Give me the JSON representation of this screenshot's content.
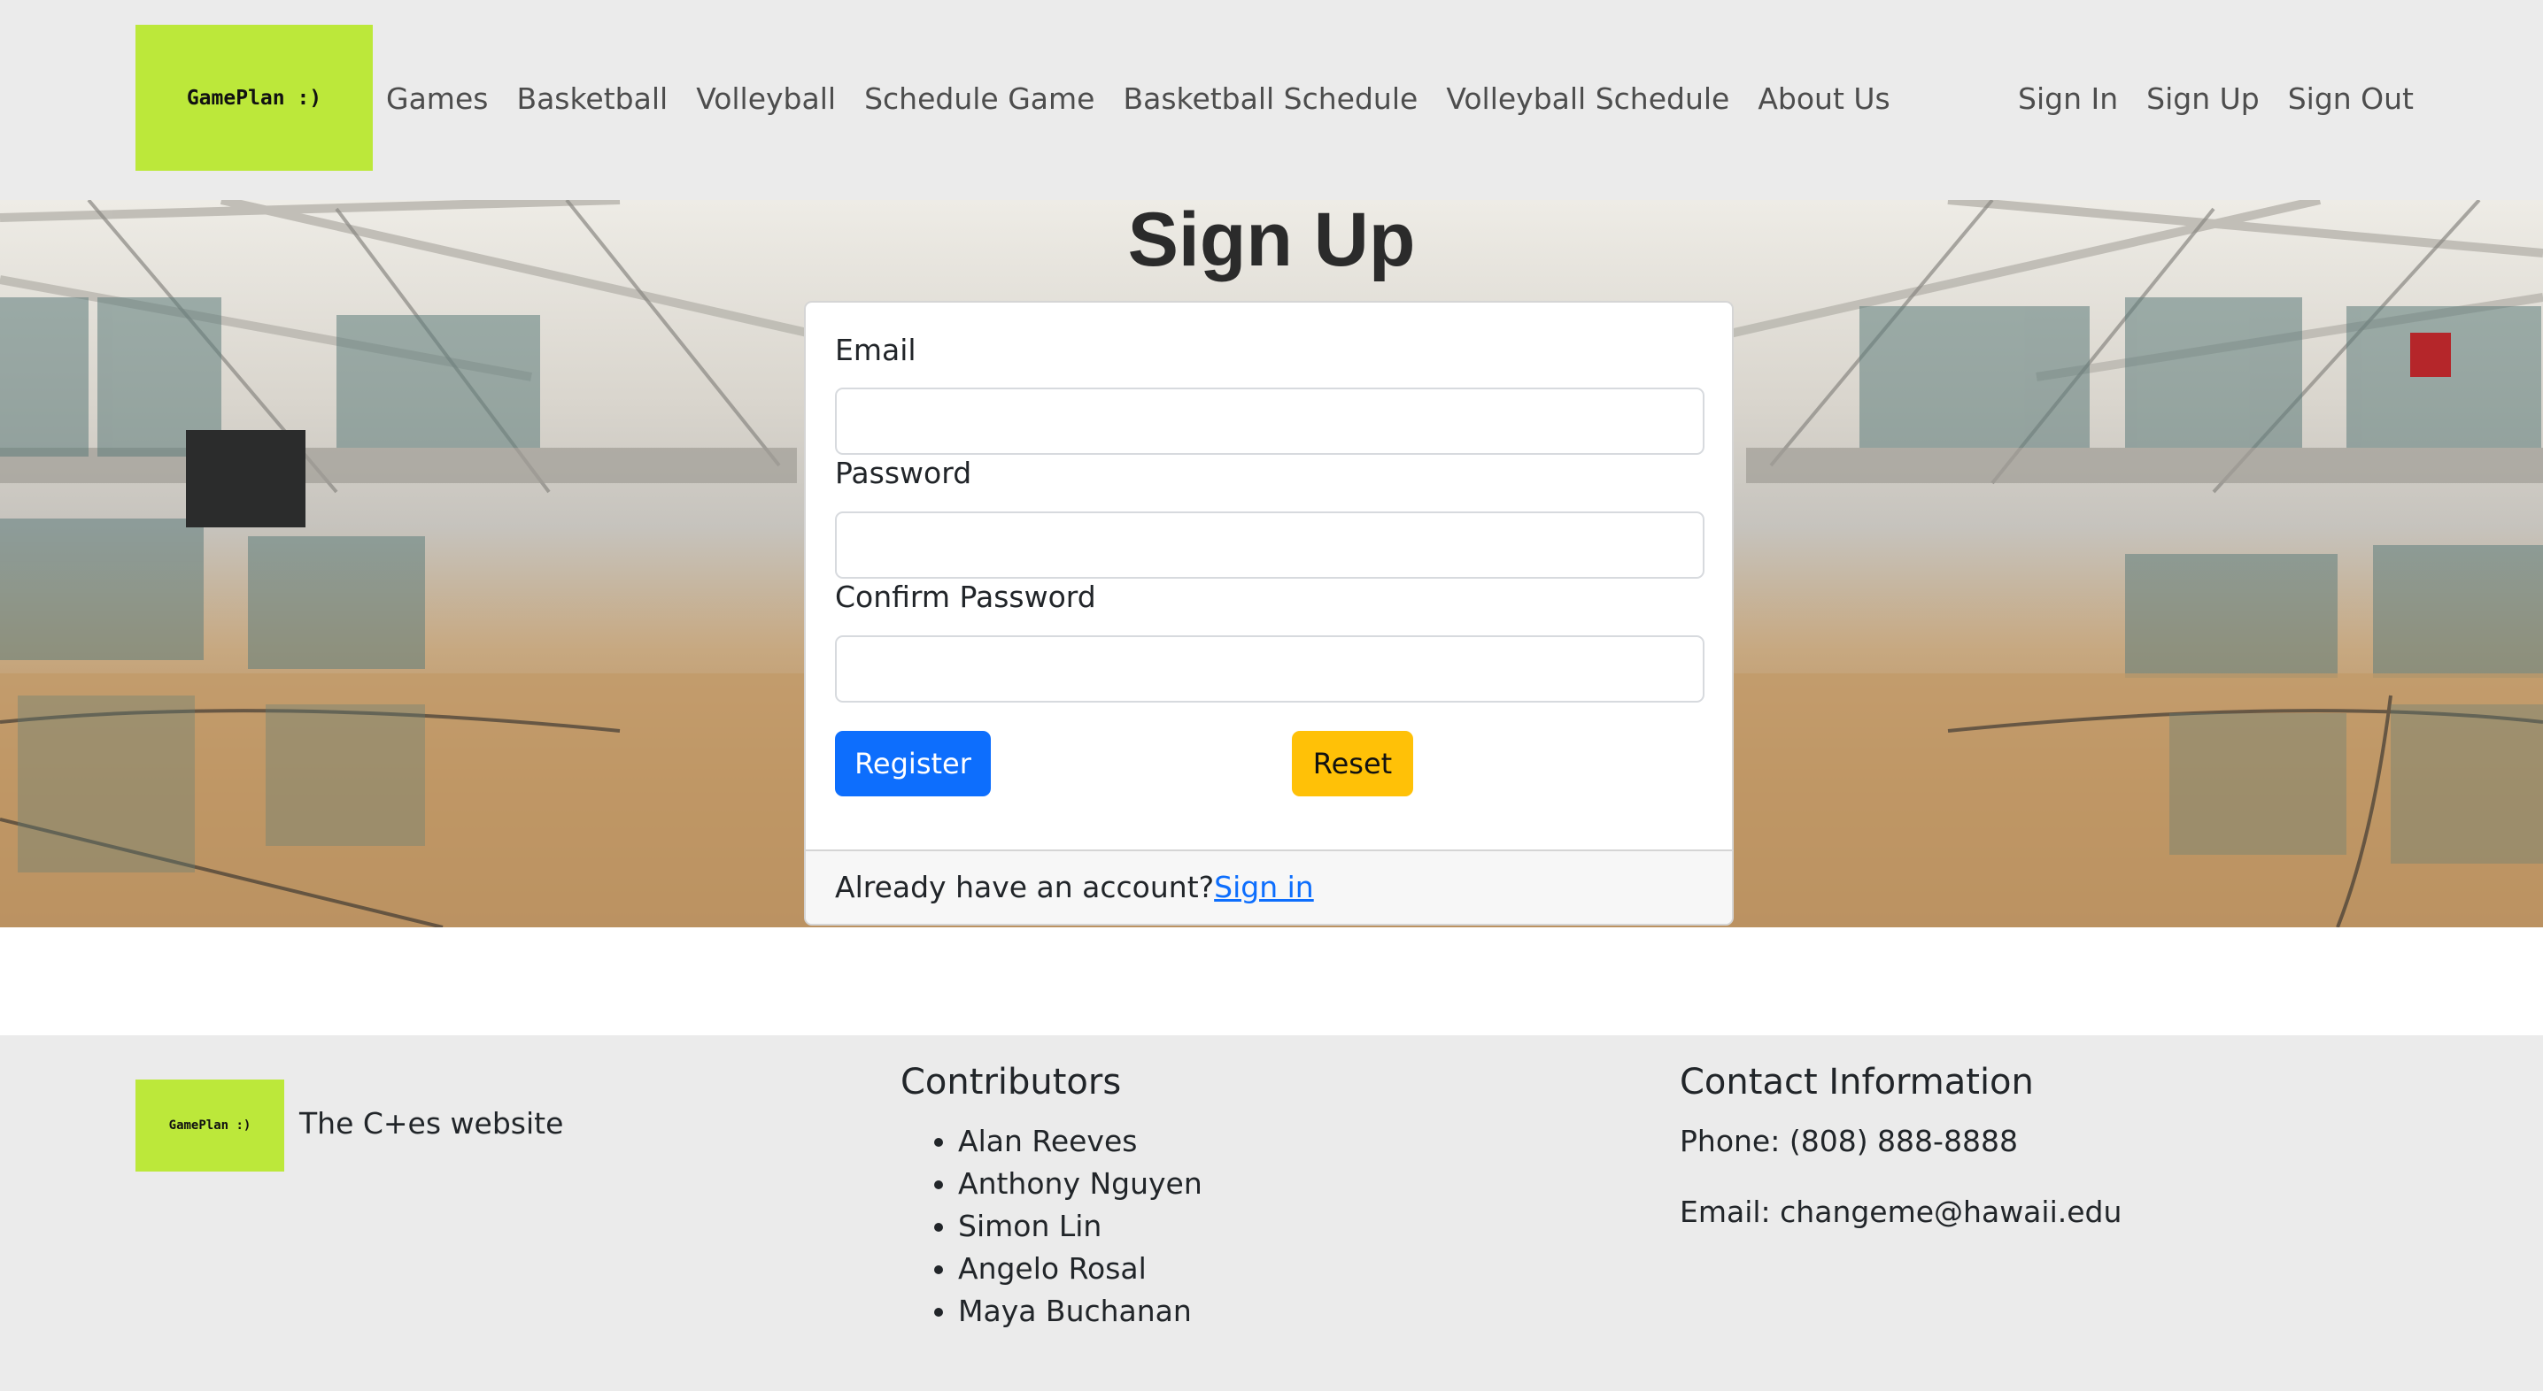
{
  "brand": {
    "logo_text": "GamePlan :)"
  },
  "nav": {
    "left": [
      "Games",
      "Basketball",
      "Volleyball",
      "Schedule Game",
      "Basketball Schedule",
      "Volleyball Schedule",
      "About Us"
    ],
    "right": [
      "Sign In",
      "Sign Up",
      "Sign Out"
    ]
  },
  "page": {
    "title": "Sign Up"
  },
  "form": {
    "email_label": "Email",
    "email_value": "",
    "password_label": "Password",
    "password_value": "",
    "confirm_label": "Confirm Password",
    "confirm_value": "",
    "register_label": "Register",
    "reset_label": "Reset",
    "footer_text": "Already have an account?",
    "signin_link": "Sign in"
  },
  "footer": {
    "logo_text": "GamePlan :)",
    "tagline": "The C+es website",
    "contributors_title": "Contributors",
    "contributors": [
      "Alan Reeves",
      "Anthony Nguyen",
      "Simon Lin",
      "Angelo Rosal",
      "Maya Buchanan"
    ],
    "contact_title": "Contact Information",
    "phone": "Phone: (808) 888-8888",
    "email": "Email: changeme@hawaii.edu"
  },
  "colors": {
    "nav_bg": "#ebebeb",
    "logo_bg": "#bce83a",
    "primary": "#0d6efd",
    "warning": "#ffc107"
  }
}
